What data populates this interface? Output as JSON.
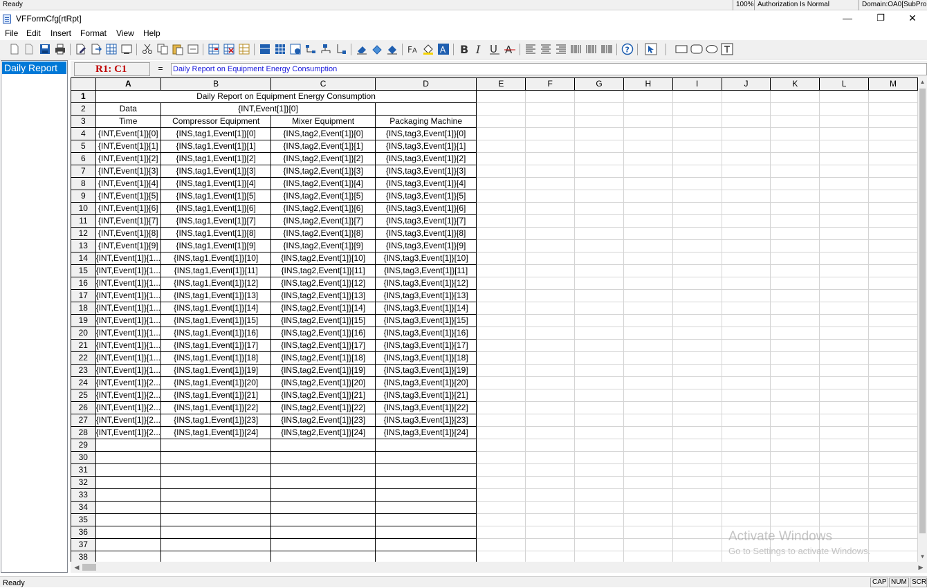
{
  "status_top": {
    "ready": "Ready",
    "zoom": "100%",
    "authorization": "Authorization Is Normal",
    "domain": "Domain:OA0[SubPro"
  },
  "window": {
    "title": "VFFormCfg[rtRpt]",
    "minimize": "—",
    "restore": "❐",
    "close": "✕"
  },
  "menu": [
    "File",
    "Edit",
    "Insert",
    "Format",
    "View",
    "Help"
  ],
  "left_panel": {
    "items": [
      "Daily Report"
    ]
  },
  "formula_bar": {
    "cell_ref": "R1: C1",
    "equals": "=",
    "content": "Daily Report on Equipment Energy Consumption"
  },
  "grid": {
    "columns": [
      "A",
      "B",
      "C",
      "D",
      "E",
      "F",
      "G",
      "H",
      "I",
      "J",
      "K",
      "L",
      "M"
    ],
    "title": "Daily Report on Equipment Energy Consumption",
    "row2": {
      "a": "Data",
      "b": "{INT,Event[1]}[0]"
    },
    "header": [
      "Time",
      "Compressor Equipment",
      "Mixer Equipment",
      "Packaging Machine"
    ],
    "data_rows": [
      [
        "{INT,Event[1]}[0]",
        "{INS,tag1,Event[1]}[0]",
        "{INS,tag2,Event[1]}[0]",
        "{INS,tag3,Event[1]}[0]"
      ],
      [
        "{INT,Event[1]}[1]",
        "{INS,tag1,Event[1]}[1]",
        "{INS,tag2,Event[1]}[1]",
        "{INS,tag3,Event[1]}[1]"
      ],
      [
        "{INT,Event[1]}[2]",
        "{INS,tag1,Event[1]}[2]",
        "{INS,tag2,Event[1]}[2]",
        "{INS,tag3,Event[1]}[2]"
      ],
      [
        "{INT,Event[1]}[3]",
        "{INS,tag1,Event[1]}[3]",
        "{INS,tag2,Event[1]}[3]",
        "{INS,tag3,Event[1]}[3]"
      ],
      [
        "{INT,Event[1]}[4]",
        "{INS,tag1,Event[1]}[4]",
        "{INS,tag2,Event[1]}[4]",
        "{INS,tag3,Event[1]}[4]"
      ],
      [
        "{INT,Event[1]}[5]",
        "{INS,tag1,Event[1]}[5]",
        "{INS,tag2,Event[1]}[5]",
        "{INS,tag3,Event[1]}[5]"
      ],
      [
        "{INT,Event[1]}[6]",
        "{INS,tag1,Event[1]}[6]",
        "{INS,tag2,Event[1]}[6]",
        "{INS,tag3,Event[1]}[6]"
      ],
      [
        "{INT,Event[1]}[7]",
        "{INS,tag1,Event[1]}[7]",
        "{INS,tag2,Event[1]}[7]",
        "{INS,tag3,Event[1]}[7]"
      ],
      [
        "{INT,Event[1]}[8]",
        "{INS,tag1,Event[1]}[8]",
        "{INS,tag2,Event[1]}[8]",
        "{INS,tag3,Event[1]}[8]"
      ],
      [
        "{INT,Event[1]}[9]",
        "{INS,tag1,Event[1]}[9]",
        "{INS,tag2,Event[1]}[9]",
        "{INS,tag3,Event[1]}[9]"
      ],
      [
        "{INT,Event[1]}[1...",
        "{INS,tag1,Event[1]}[10]",
        "{INS,tag2,Event[1]}[10]",
        "{INS,tag3,Event[1]}[10]"
      ],
      [
        "{INT,Event[1]}[1...",
        "{INS,tag1,Event[1]}[11]",
        "{INS,tag2,Event[1]}[11]",
        "{INS,tag3,Event[1]}[11]"
      ],
      [
        "{INT,Event[1]}[1...",
        "{INS,tag1,Event[1]}[12]",
        "{INS,tag2,Event[1]}[12]",
        "{INS,tag3,Event[1]}[12]"
      ],
      [
        "{INT,Event[1]}[1...",
        "{INS,tag1,Event[1]}[13]",
        "{INS,tag2,Event[1]}[13]",
        "{INS,tag3,Event[1]}[13]"
      ],
      [
        "{INT,Event[1]}[1...",
        "{INS,tag1,Event[1]}[14]",
        "{INS,tag2,Event[1]}[14]",
        "{INS,tag3,Event[1]}[14]"
      ],
      [
        "{INT,Event[1]}[1...",
        "{INS,tag1,Event[1]}[15]",
        "{INS,tag2,Event[1]}[15]",
        "{INS,tag3,Event[1]}[15]"
      ],
      [
        "{INT,Event[1]}[1...",
        "{INS,tag1,Event[1]}[16]",
        "{INS,tag2,Event[1]}[16]",
        "{INS,tag3,Event[1]}[16]"
      ],
      [
        "{INT,Event[1]}[1...",
        "{INS,tag1,Event[1]}[17]",
        "{INS,tag2,Event[1]}[17]",
        "{INS,tag3,Event[1]}[17]"
      ],
      [
        "{INT,Event[1]}[1...",
        "{INS,tag1,Event[1]}[18]",
        "{INS,tag2,Event[1]}[18]",
        "{INS,tag3,Event[1]}[18]"
      ],
      [
        "{INT,Event[1]}[1...",
        "{INS,tag1,Event[1]}[19]",
        "{INS,tag2,Event[1]}[19]",
        "{INS,tag3,Event[1]}[19]"
      ],
      [
        "{INT,Event[1]}[2...",
        "{INS,tag1,Event[1]}[20]",
        "{INS,tag2,Event[1]}[20]",
        "{INS,tag3,Event[1]}[20]"
      ],
      [
        "{INT,Event[1]}[2...",
        "{INS,tag1,Event[1]}[21]",
        "{INS,tag2,Event[1]}[21]",
        "{INS,tag3,Event[1]}[21]"
      ],
      [
        "{INT,Event[1]}[2...",
        "{INS,tag1,Event[1]}[22]",
        "{INS,tag2,Event[1]}[22]",
        "{INS,tag3,Event[1]}[22]"
      ],
      [
        "{INT,Event[1]}[2...",
        "{INS,tag1,Event[1]}[23]",
        "{INS,tag2,Event[1]}[23]",
        "{INS,tag3,Event[1]}[23]"
      ],
      [
        "{INT,Event[1]}[2...",
        "{INS,tag1,Event[1]}[24]",
        "{INS,tag2,Event[1]}[24]",
        "{INS,tag3,Event[1]}[24]"
      ]
    ],
    "total_rows": 38
  },
  "watermark": {
    "line1": "Activate Windows",
    "line2": "Go to Settings to activate Windows."
  },
  "status_bottom": {
    "ready": "Ready",
    "cap": "CAP",
    "num": "NUM",
    "scrl": "SCRL"
  },
  "toolbar": {
    "icons": [
      "new-icon",
      "open-icon",
      "save-icon",
      "print-icon",
      "edit-icon",
      "export-icon",
      "grid-icon",
      "preview-icon",
      "cut-icon",
      "copy-icon",
      "paste-icon",
      "undo-icon",
      "insert-row-icon",
      "delete-row-icon",
      "format-icon",
      "merge-icon",
      "table-icon",
      "settings-icon",
      "tree-icon",
      "chart-icon",
      "eraser-icon",
      "fill-icon",
      "clear-icon",
      "font-icon",
      "paint-bucket-icon",
      "text-color-icon",
      "bold-icon",
      "italic-icon",
      "underline-icon",
      "strikethrough-icon",
      "align-left-icon",
      "align-center-icon",
      "align-right-icon",
      "barcode1-icon",
      "barcode2-icon",
      "barcode3-icon",
      "help-icon",
      "pointer-icon",
      "rectangle-icon",
      "rounded-rect-icon",
      "ellipse-icon",
      "textbox-icon"
    ]
  }
}
